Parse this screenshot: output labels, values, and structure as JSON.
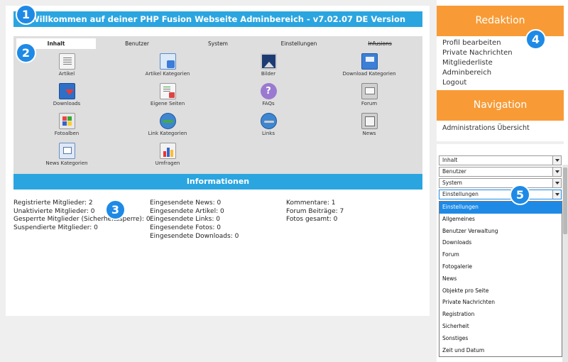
{
  "title": "Willkommen auf deiner PHP Fusion Webseite Adminbereich - v7.02.07 DE Version",
  "tabs": [
    "Inhalt",
    "Benutzer",
    "System",
    "Einstellungen",
    "Infusions"
  ],
  "admin_items": [
    {
      "label": "Artikel",
      "icon": "article-icon"
    },
    {
      "label": "Artikel Kategorien",
      "icon": "article-categories-icon"
    },
    {
      "label": "Bilder",
      "icon": "images-icon"
    },
    {
      "label": "Download Kategorien",
      "icon": "download-categories-icon"
    },
    {
      "label": "Downloads",
      "icon": "downloads-icon"
    },
    {
      "label": "Eigene Seiten",
      "icon": "custom-pages-icon"
    },
    {
      "label": "FAQs",
      "icon": "faq-icon"
    },
    {
      "label": "Forum",
      "icon": "forum-icon"
    },
    {
      "label": "Fotoalben",
      "icon": "photo-albums-icon"
    },
    {
      "label": "Link Kategorien",
      "icon": "link-categories-icon"
    },
    {
      "label": "Links",
      "icon": "links-icon"
    },
    {
      "label": "News",
      "icon": "news-icon"
    },
    {
      "label": "News Kategorien",
      "icon": "news-categories-icon"
    },
    {
      "label": "Umfragen",
      "icon": "polls-icon"
    }
  ],
  "info_title": "Informationen",
  "stats": {
    "col1": [
      "Registrierte Mitglieder: 2",
      "Unaktivierte Mitglieder: 0",
      "Gesperrte Mitglieder (Sicherheitssperre): 0",
      "Suspendierte Mitglieder: 0"
    ],
    "col2": [
      "Eingesendete News: 0",
      "Eingesendete Artikel: 0",
      "Eingesendete Links: 0",
      "Eingesendete Fotos: 0",
      "Eingesendete Downloads: 0"
    ],
    "col3": [
      "Kommentare: 1",
      "Forum Beiträge: 7",
      "Fotos gesamt: 0"
    ]
  },
  "redaktion": {
    "title": "Redaktion",
    "links": [
      "Profil bearbeiten",
      "Private Nachrichten",
      "Mitgliederliste",
      "Adminbereich",
      "Logout"
    ]
  },
  "navigation": {
    "title": "Navigation",
    "links": [
      "Administrations Übersicht"
    ]
  },
  "selects": [
    "Inhalt",
    "Benutzer",
    "System",
    "Einstellungen"
  ],
  "dropdown_options": [
    "Einstellungen",
    "Allgemeines",
    "Benutzer Verwaltung",
    "Downloads",
    "Forum",
    "Fotogalerie",
    "News",
    "Objekte pro Seite",
    "Private Nachrichten",
    "Registration",
    "Sicherheit",
    "Sonstiges",
    "Zeit und Datum"
  ],
  "badges": [
    "1",
    "2",
    "3",
    "4",
    "5"
  ],
  "colors": {
    "blue": "#2ba5e0",
    "orange": "#f89b36",
    "badge": "#1e8ae6"
  }
}
